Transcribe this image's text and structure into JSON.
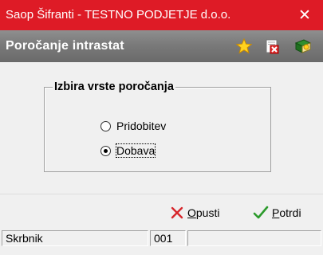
{
  "window": {
    "title": "Saop Šifranti - TESTNO PODJETJE d.o.o.",
    "close_glyph": "✕",
    "accent_color": "#de1b26"
  },
  "header": {
    "title": "Poročanje intrastat",
    "icons": [
      "star-icon",
      "document-delete-icon",
      "book-help-icon"
    ]
  },
  "group": {
    "legend": "Izbira vrste poročanja",
    "options": [
      {
        "label": "Pridobitev",
        "checked": false
      },
      {
        "label": "Dobava",
        "checked": true
      }
    ]
  },
  "buttons": {
    "cancel": {
      "label_accel": "O",
      "label_rest": "pusti"
    },
    "confirm": {
      "label_accel": "P",
      "label_rest": "otrdi"
    }
  },
  "status": {
    "user": "Skrbnik",
    "code": "001",
    "extra": ""
  }
}
